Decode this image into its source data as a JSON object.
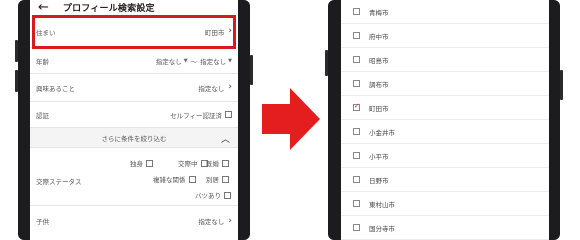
{
  "left_screen": {
    "header": {
      "back_icon": "←",
      "title": "プロフィール検索設定"
    },
    "residence": {
      "label": "住まい",
      "value": "町田市"
    },
    "age": {
      "label": "年齢",
      "from": "指定なし",
      "separator": "〜",
      "to": "指定なし"
    },
    "interests": {
      "label": "興味あること",
      "value": "指定なし"
    },
    "verification": {
      "label": "認証",
      "value": "セルフィー認証済"
    },
    "refine": {
      "label": "さらに条件を絞り込む"
    },
    "relationship": {
      "label": "交際ステータス",
      "options": [
        "独身",
        "交際中",
        "既婚",
        "複雑な関係",
        "別居",
        "バツあり"
      ]
    },
    "children": {
      "label": "子供",
      "value": "指定なし"
    }
  },
  "right_screen": {
    "cities": [
      {
        "name": "青梅市",
        "checked": false
      },
      {
        "name": "府中市",
        "checked": false
      },
      {
        "name": "昭島市",
        "checked": false
      },
      {
        "name": "調布市",
        "checked": false
      },
      {
        "name": "町田市",
        "checked": true
      },
      {
        "name": "小金井市",
        "checked": false
      },
      {
        "name": "小平市",
        "checked": false
      },
      {
        "name": "日野市",
        "checked": false
      },
      {
        "name": "東村山市",
        "checked": false
      },
      {
        "name": "国分寺市",
        "checked": false
      }
    ]
  },
  "colors": {
    "highlight": "#d71920",
    "arrow": "#e41e1e"
  }
}
